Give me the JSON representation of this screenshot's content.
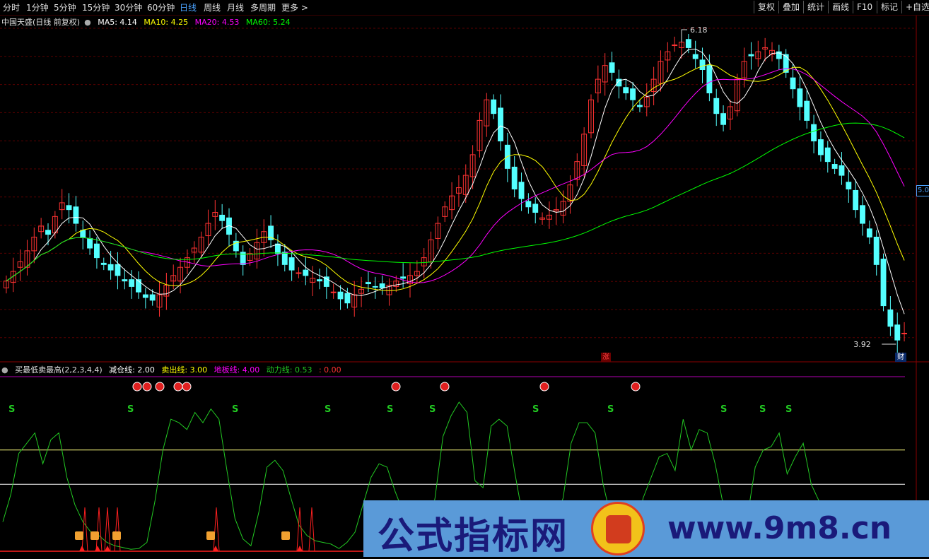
{
  "toolbar": {
    "left_items": [
      "分时",
      "1分钟",
      "5分钟",
      "15分钟",
      "30分钟",
      "60分钟",
      "日线",
      "周线",
      "月线",
      "多周期",
      "更多 >"
    ],
    "active": "日线",
    "right_items": [
      "复权",
      "叠加",
      "统计",
      "画线",
      "F10",
      "标记",
      "+自选"
    ]
  },
  "main_legend": {
    "title": "中国天盛(日线 前复权)",
    "ma5": "MA5: 4.14",
    "ma10": "MA10: 4.25",
    "ma20": "MA20: 4.53",
    "ma60": "MA60: 5.24"
  },
  "indicator_legend": {
    "name": "买最低卖最高(2,2,3,4,4)",
    "l1": "减仓线: 2.00",
    "l2": "卖出线: 3.00",
    "l3": "地板线: 4.00",
    "l4": "动力线: 0.53",
    "l5": ": 0.00"
  },
  "labels": {
    "high_price": "6.18",
    "low_price": "3.92",
    "price_axis_tag": "5.0",
    "zhang_badge": "涨",
    "cai_badge": "财",
    "s_marker": "S"
  },
  "watermark": {
    "title": "公式指标网",
    "url": "www.9m8.cn"
  },
  "colors": {
    "up": "#ff3232",
    "down": "#54ffff",
    "ma5": "#ffffff",
    "ma10": "#ffff00",
    "ma20": "#ff00ff",
    "ma60": "#00ff00",
    "power_line": "#22c822",
    "s_marker": "#22cc22",
    "grid": "#5a0000"
  },
  "chart_data": [
    {
      "type": "candlestick",
      "title": "中国天盛(日线 前复权)",
      "ylim": [
        3.92,
        6.18
      ],
      "series": [
        {
          "name": "MA5",
          "value": 4.14
        },
        {
          "name": "MA10",
          "value": 4.25
        },
        {
          "name": "MA20",
          "value": 4.53
        },
        {
          "name": "MA60",
          "value": 5.24
        }
      ],
      "close": [
        4.38,
        4.45,
        4.52,
        4.6,
        4.7,
        4.78,
        4.72,
        4.85,
        4.95,
        4.9,
        4.8,
        4.7,
        4.62,
        4.55,
        4.5,
        4.46,
        4.42,
        4.38,
        4.34,
        4.3,
        4.26,
        4.24,
        4.28,
        4.35,
        4.42,
        4.48,
        4.55,
        4.62,
        4.7,
        4.8,
        4.88,
        4.82,
        4.72,
        4.6,
        4.5,
        4.58,
        4.66,
        4.74,
        4.68,
        4.58,
        4.5,
        4.46,
        4.44,
        4.42,
        4.4,
        4.38,
        4.34,
        4.3,
        4.25,
        4.22,
        4.28,
        4.32,
        4.36,
        4.34,
        4.33,
        4.35,
        4.38,
        4.4,
        4.42,
        4.45,
        4.55,
        4.68,
        4.8,
        4.92,
        5.0,
        5.06,
        5.15,
        5.3,
        5.55,
        5.7,
        5.6,
        5.4,
        5.2,
        5.05,
        4.98,
        4.92,
        4.88,
        4.84,
        4.86,
        4.9,
        4.96,
        5.08,
        5.25,
        5.45,
        5.7,
        5.85,
        5.95,
        5.9,
        5.8,
        5.75,
        5.7,
        5.65,
        5.72,
        5.85,
        5.98,
        6.05,
        6.1,
        6.12,
        6.08,
        6.0,
        5.92,
        5.75,
        5.6,
        5.52,
        5.65,
        5.85,
        5.98,
        6.02,
        6.05,
        6.08,
        6.06,
        6.0,
        5.9,
        5.78,
        5.65,
        5.55,
        5.4,
        5.3,
        5.25,
        5.2,
        5.15,
        5.05,
        4.9,
        4.8,
        4.7,
        4.5,
        4.2,
        4.05,
        3.95,
        4.0
      ]
    },
    {
      "type": "line",
      "title": "买最低卖最高(2,2,3,4,4)",
      "ylim": [
        0,
        5
      ],
      "series": [
        {
          "name": "减仓线",
          "value": 2.0
        },
        {
          "name": "卖出线",
          "value": 3.0
        },
        {
          "name": "地板线",
          "value": 4.0
        },
        {
          "name": "动力线",
          "value": 0.53,
          "values": [
            0.9,
            1.7,
            2.9,
            3.2,
            3.5,
            2.6,
            3.3,
            3.5,
            2.2,
            1.4,
            0.9,
            0.6,
            0.5,
            0.3,
            0.2,
            0.15,
            0.1,
            0.12,
            0.3,
            1.5,
            3.0,
            3.9,
            3.8,
            3.6,
            4.1,
            3.8,
            4.2,
            3.9,
            2.4,
            1.0,
            0.4,
            0.2,
            1.2,
            2.5,
            2.7,
            2.4,
            1.6,
            0.8,
            0.5,
            0.35,
            0.3,
            0.25,
            0.12,
            0.3,
            0.6,
            1.4,
            2.2,
            2.6,
            2.5,
            1.8,
            1.2,
            0.6,
            0.4,
            0.3,
            1.6,
            3.4,
            4.0,
            4.4,
            4.1,
            2.1,
            1.9,
            3.7,
            3.9,
            3.7,
            2.3,
            1.0,
            0.6,
            0.35,
            0.3,
            0.9,
            1.6,
            3.2,
            3.8,
            3.8,
            3.5,
            2.0,
            1.0,
            0.9,
            0.5,
            0.6,
            1.6,
            2.2,
            2.8,
            2.9,
            2.4,
            3.9,
            3.0,
            3.6,
            3.5,
            2.6,
            1.4,
            0.8,
            0.5,
            1.0,
            2.5,
            3.0,
            3.1,
            3.5,
            2.3,
            2.8,
            3.2,
            2.0,
            1.5,
            1.0,
            1.2,
            1.0,
            0.8
          ]
        }
      ]
    }
  ]
}
